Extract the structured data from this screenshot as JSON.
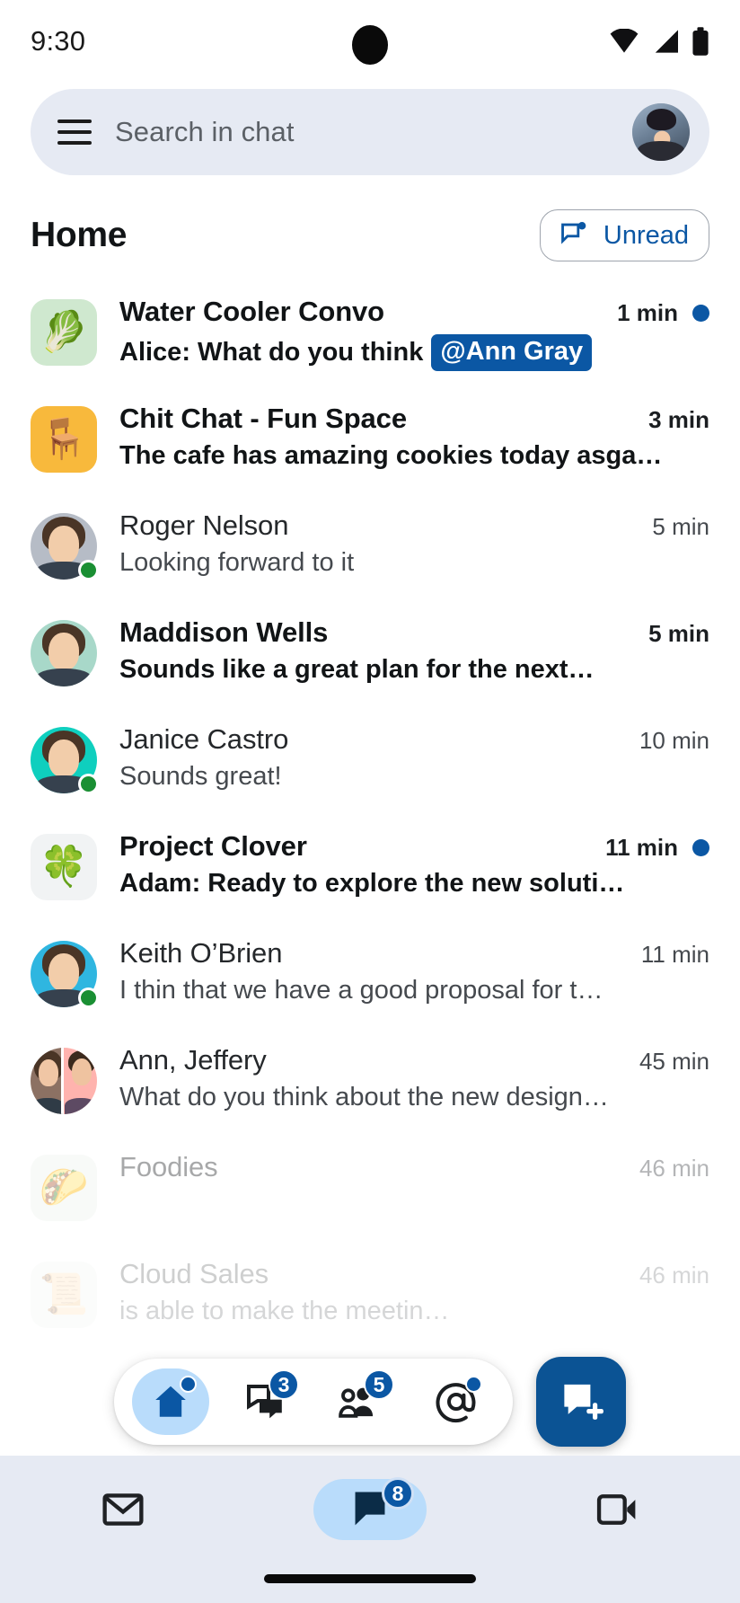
{
  "status_bar": {
    "time": "9:30",
    "icons": [
      "wifi-icon",
      "cellular-signal-icon",
      "battery-icon"
    ]
  },
  "search": {
    "placeholder": "Search in chat",
    "menu_icon": "hamburger-menu-icon",
    "avatar_label": "account-avatar"
  },
  "header": {
    "title": "Home",
    "unread_filter": {
      "label": "Unread",
      "icon": "unread-chat-icon"
    }
  },
  "colors": {
    "accent_blue": "#0b57a4",
    "fab_blue": "#0b5394",
    "chip_surface": "#e6eaf3",
    "active_pill": "#b9dcfb",
    "presence_green": "#1a8f33"
  },
  "conversations": [
    {
      "name": "Water Cooler Convo",
      "snippet": "Alice: What do you think",
      "mention": "@Ann Gray",
      "time": "1 min",
      "unread": true,
      "unread_dot": true,
      "avatar_type": "square-emoji",
      "avatar_emoji": "🥬",
      "avatar_bg": "#cfe8cf",
      "presence": false
    },
    {
      "name": "Chit Chat - Fun Space",
      "snippet": "The cafe has amazing cookies today asga…",
      "mention": "",
      "time": "3 min",
      "unread": true,
      "unread_dot": false,
      "avatar_type": "square-emoji",
      "avatar_emoji": "🪑",
      "avatar_bg": "#f8b93c",
      "presence": false
    },
    {
      "name": "Roger Nelson",
      "snippet": "Looking forward to it",
      "mention": "",
      "time": "5 min",
      "unread": false,
      "unread_dot": false,
      "avatar_type": "photo",
      "avatar_bg": "#b6bcc6",
      "presence": true
    },
    {
      "name": "Maddison Wells",
      "snippet": "Sounds like a great plan for the next…",
      "mention": "",
      "time": "5 min",
      "unread": true,
      "unread_dot": false,
      "avatar_type": "photo",
      "avatar_bg": "#a8d8c9",
      "presence": false
    },
    {
      "name": "Janice Castro",
      "snippet": "Sounds great!",
      "mention": "",
      "time": "10 min",
      "unread": false,
      "unread_dot": false,
      "avatar_type": "photo",
      "avatar_bg": "#0fcfbe",
      "presence": true
    },
    {
      "name": "Project Clover",
      "snippet": "Adam: Ready to explore the new soluti…",
      "mention": "",
      "time": "11 min",
      "unread": true,
      "unread_dot": true,
      "avatar_type": "square-emoji",
      "avatar_emoji": "🍀",
      "avatar_bg": "#f1f3f4",
      "presence": false
    },
    {
      "name": "Keith O’Brien",
      "snippet": "I thin that we have a good proposal for t…",
      "mention": "",
      "time": "11 min",
      "unread": false,
      "unread_dot": false,
      "avatar_type": "photo",
      "avatar_bg": "#2fb6e0",
      "presence": true
    },
    {
      "name": "Ann, Jeffery",
      "snippet": "What do you think about the new design…",
      "mention": "",
      "time": "45 min",
      "unread": false,
      "unread_dot": false,
      "avatar_type": "split",
      "avatar_bg": "#8c7163",
      "avatar_bg2": "#ffb3ae",
      "presence": false
    },
    {
      "name": "Foodies",
      "snippet": "",
      "mention": "",
      "time": "46 min",
      "unread": false,
      "unread_dot": false,
      "avatar_type": "square-emoji",
      "avatar_emoji": "🌮",
      "avatar_bg": "#eff3ef",
      "presence": false,
      "fade": 1
    },
    {
      "name": "Cloud Sales",
      "snippet": "is able to make the meetin…",
      "mention": "",
      "time": "46 min",
      "unread": false,
      "unread_dot": false,
      "avatar_type": "square-emoji",
      "avatar_emoji": "📜",
      "avatar_bg": "#eff3ef",
      "presence": false,
      "fade": 2
    }
  ],
  "bottom_nav": {
    "items": [
      {
        "icon": "home-icon",
        "active": true,
        "badge": "",
        "badge_dot": true
      },
      {
        "icon": "chat-bubbles-icon",
        "active": false,
        "badge": "3",
        "badge_dot": false
      },
      {
        "icon": "people-group-icon",
        "active": false,
        "badge": "5",
        "badge_dot": false
      },
      {
        "icon": "mentions-at-icon",
        "active": false,
        "badge": "",
        "badge_dot": true
      }
    ],
    "fab": {
      "icon": "compose-chat-icon"
    }
  },
  "app_switcher": {
    "items": [
      {
        "icon": "mail-icon",
        "active": false,
        "badge": ""
      },
      {
        "icon": "chat-flag-icon",
        "active": true,
        "badge": "8"
      },
      {
        "icon": "meet-video-icon",
        "active": false,
        "badge": ""
      }
    ]
  }
}
